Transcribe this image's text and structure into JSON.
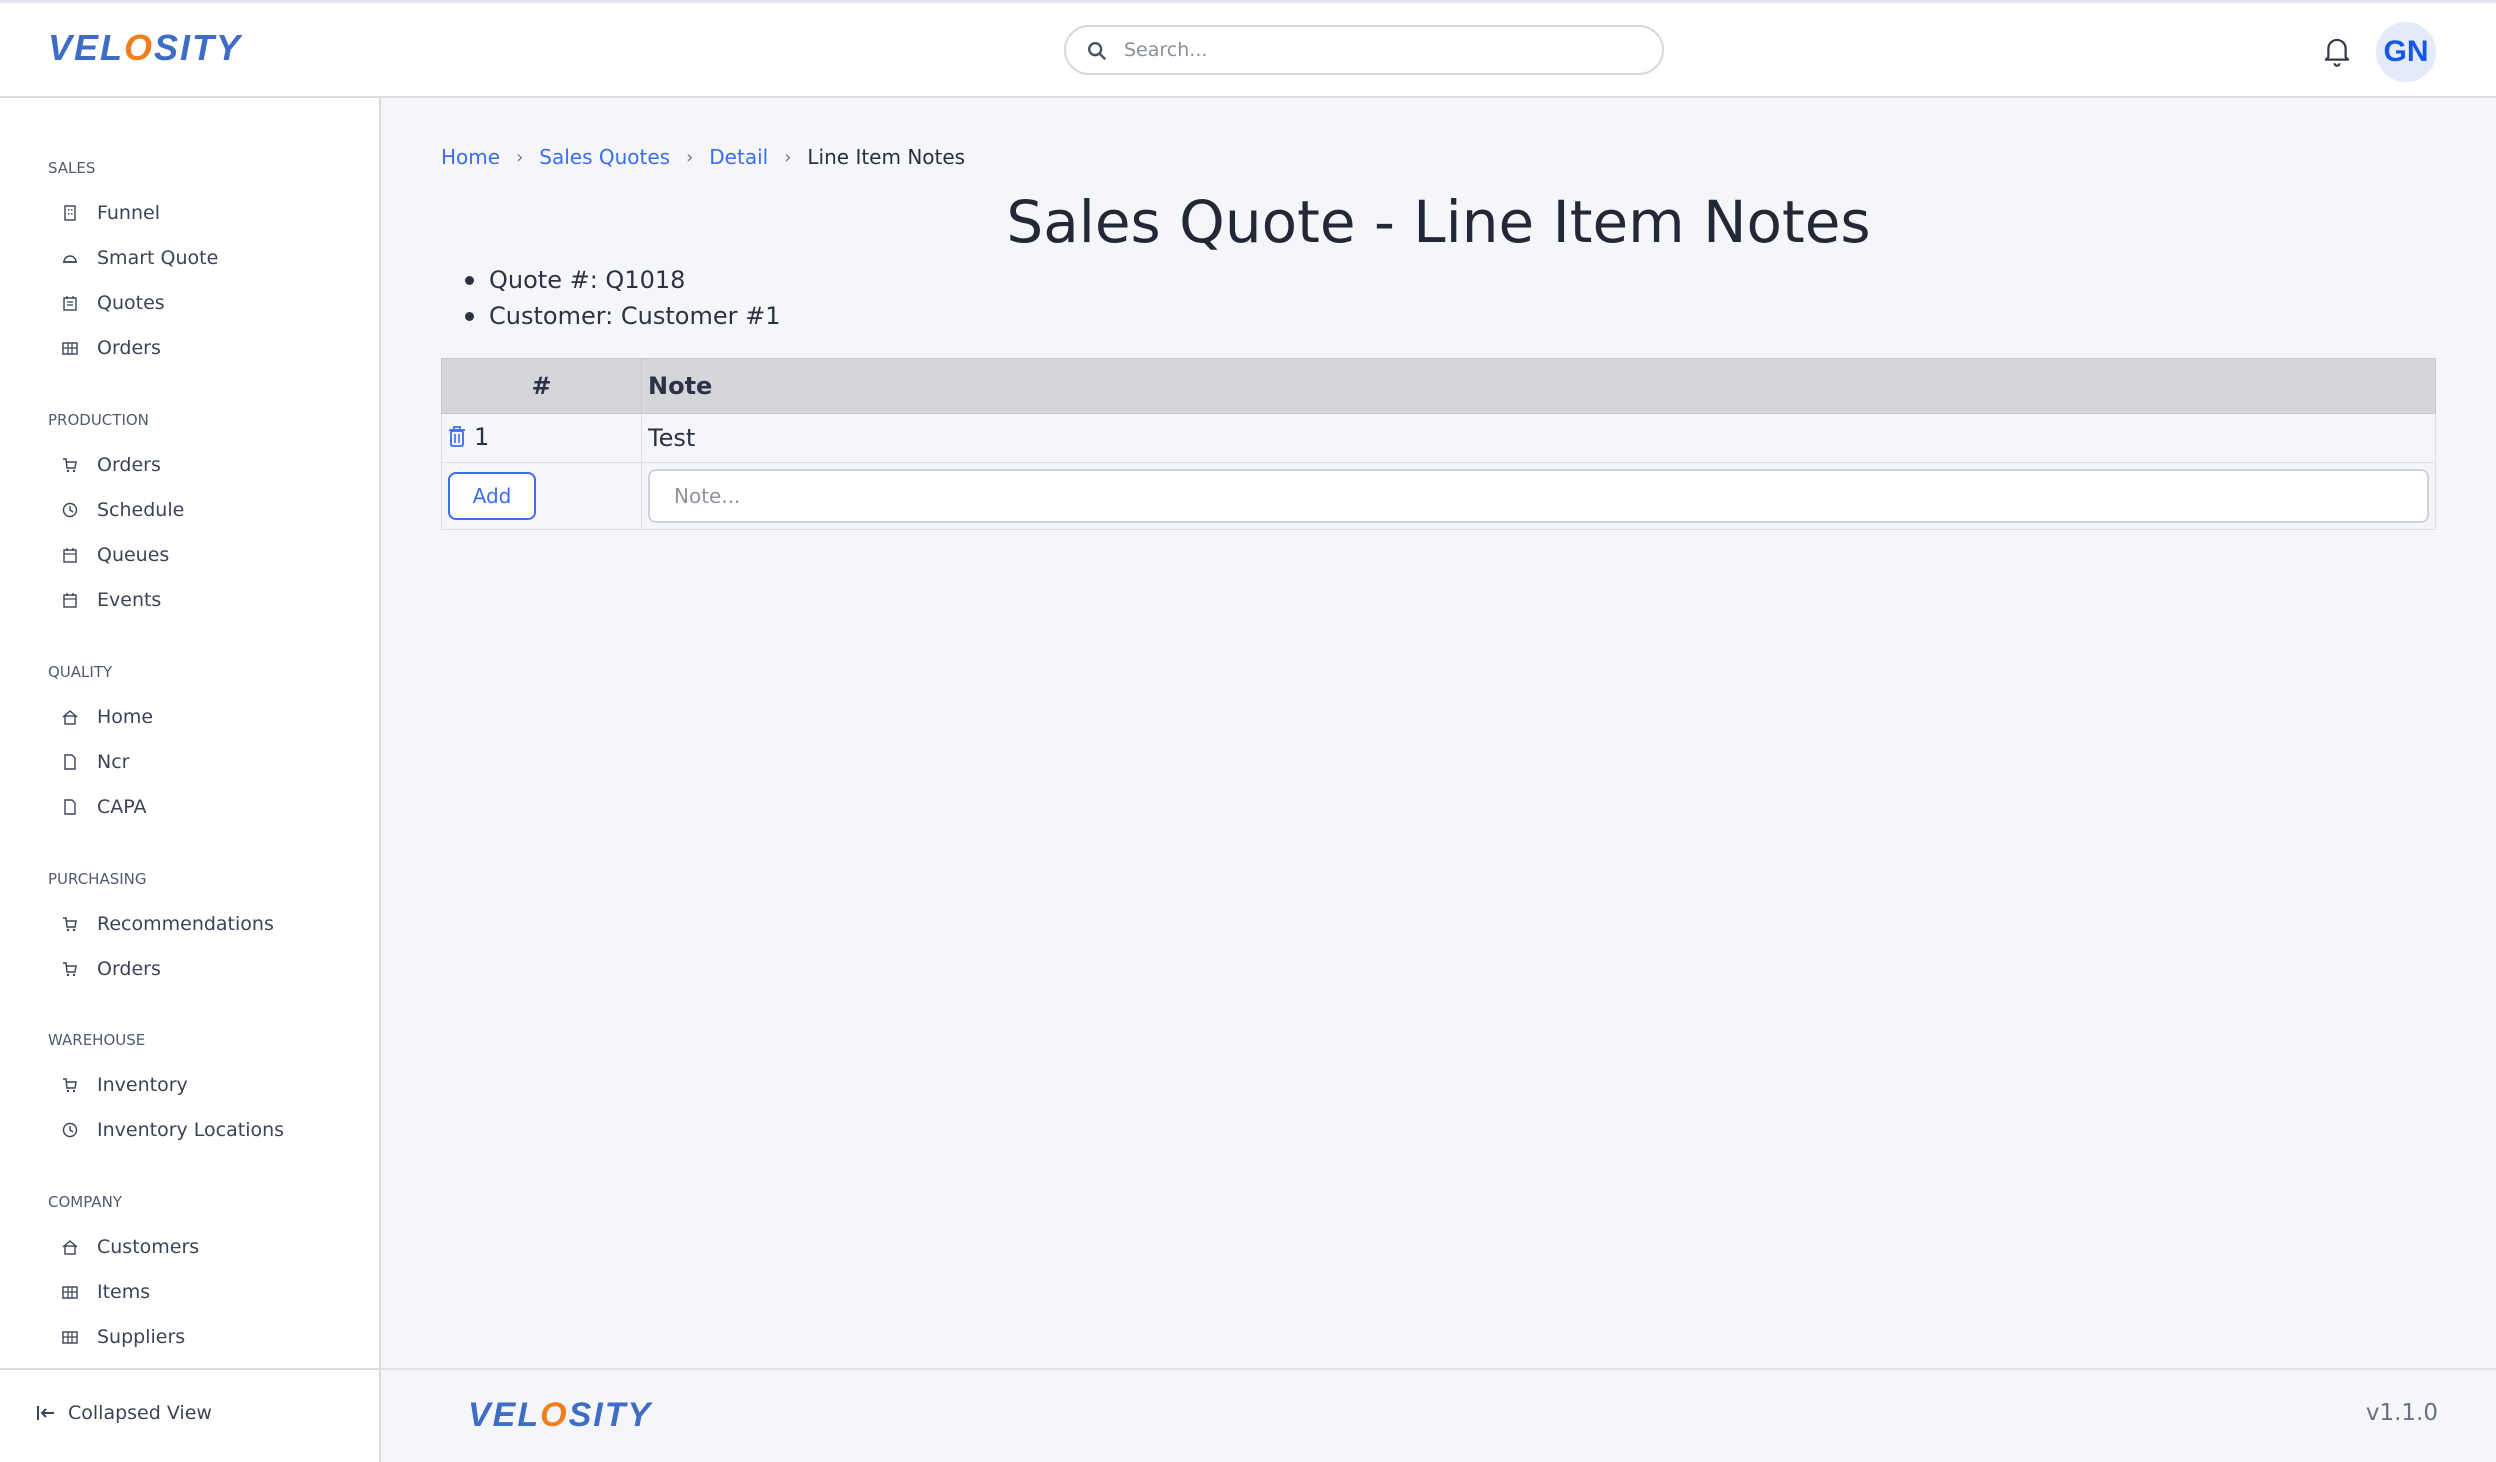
{
  "brand": {
    "logo_text_a": "VEL",
    "logo_text_o": "O",
    "logo_text_b": "SITY",
    "accent": "#3c6df0",
    "logo_orange": "#f07f20"
  },
  "header": {
    "search_placeholder": "Search...",
    "avatar_initials": "GN",
    "notification_icon": "bell-icon"
  },
  "sidebar": {
    "sections": [
      {
        "title": "SALES",
        "items": [
          {
            "label": "Funnel",
            "icon": "building-icon"
          },
          {
            "label": "Smart Quote",
            "icon": "helmet-icon"
          },
          {
            "label": "Quotes",
            "icon": "clipboard-icon"
          },
          {
            "label": "Orders",
            "icon": "warehouse-icon"
          }
        ]
      },
      {
        "title": "PRODUCTION",
        "items": [
          {
            "label": "Orders",
            "icon": "cart-icon"
          },
          {
            "label": "Schedule",
            "icon": "clock-icon"
          },
          {
            "label": "Queues",
            "icon": "calendar-icon"
          },
          {
            "label": "Events",
            "icon": "calendar-icon"
          }
        ]
      },
      {
        "title": "QUALITY",
        "items": [
          {
            "label": "Home",
            "icon": "home-icon"
          },
          {
            "label": "Ncr",
            "icon": "file-icon"
          },
          {
            "label": "CAPA",
            "icon": "file-icon"
          }
        ]
      },
      {
        "title": "PURCHASING",
        "items": [
          {
            "label": "Recommendations",
            "icon": "cart-icon"
          },
          {
            "label": "Orders",
            "icon": "cart-icon"
          }
        ]
      },
      {
        "title": "WAREHOUSE",
        "items": [
          {
            "label": "Inventory",
            "icon": "cart-icon"
          },
          {
            "label": "Inventory Locations",
            "icon": "clock-icon"
          }
        ]
      },
      {
        "title": "COMPANY",
        "items": [
          {
            "label": "Customers",
            "icon": "home-icon"
          },
          {
            "label": "Items",
            "icon": "warehouse-icon"
          },
          {
            "label": "Suppliers",
            "icon": "warehouse-icon"
          }
        ]
      }
    ],
    "collapse_label": "Collapsed View"
  },
  "breadcrumb": [
    {
      "label": "Home"
    },
    {
      "label": "Sales Quotes"
    },
    {
      "label": "Detail"
    },
    {
      "label": "Line Item Notes"
    }
  ],
  "page": {
    "title": "Sales Quote - Line Item Notes",
    "info": [
      "Quote #: Q1018",
      "Customer: Customer #1"
    ]
  },
  "table": {
    "headers": [
      "#",
      "Note"
    ],
    "rows": [
      {
        "num": "1",
        "note": "Test"
      }
    ],
    "add_label": "Add",
    "note_placeholder": "Note..."
  },
  "footer": {
    "version": "v1.1.0"
  }
}
